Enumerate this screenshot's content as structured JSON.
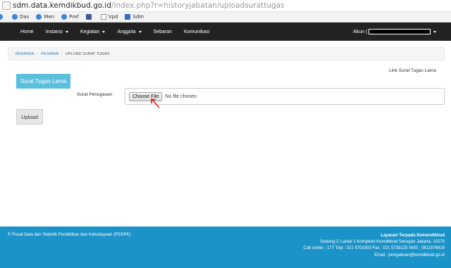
{
  "browser": {
    "url_host": "sdm.data.kemdikbud.go.id",
    "url_path": "/index.php?r=historyjabatan/uploadsurattugas",
    "bookmarks": [
      "Das",
      "Men",
      "Pref",
      "",
      "Vpd",
      "Sdm"
    ]
  },
  "nav": {
    "items": [
      {
        "label": "Home",
        "dropdown": false
      },
      {
        "label": "Instansi",
        "dropdown": true
      },
      {
        "label": "Kegiatan",
        "dropdown": true
      },
      {
        "label": "Anggota",
        "dropdown": true
      },
      {
        "label": "Sebaran",
        "dropdown": false
      },
      {
        "label": "Komunikasi",
        "dropdown": false
      }
    ],
    "account_label": "Akun ("
  },
  "breadcrumb": {
    "home": "BERANDA",
    "section": "PEGAWAI",
    "current": "UPLOAD SURAT TUGAS"
  },
  "page": {
    "link_lama": "Link Surat Tugas Lama",
    "surat_lama_button": "Surat Tugas Lama",
    "field_label": "Surat Penugasan",
    "choose_file_label": "Choose File",
    "file_status": "No file chosen",
    "upload_button": "Upload"
  },
  "footer": {
    "copyright": "© Pusat Data dan Statistik Pendidikan dan Kebudayaan (PDSPK)",
    "contact_title": "Layanan Terpadu Kemendikbud",
    "address": "Gedung C Lantai 1 Kompleks Kemdikbud Senayan Jakarta, 10270",
    "callcenter": "Call center : 177 Telp : 021 5703303 Fax : 021 5733125 SMS : 0811976929",
    "email": "Email : pengaduan@kemdikbud.go.id"
  },
  "colors": {
    "navbar": "#222222",
    "info_button": "#5bc0de",
    "footer": "#1b93c8",
    "arrow": "#e02020"
  }
}
